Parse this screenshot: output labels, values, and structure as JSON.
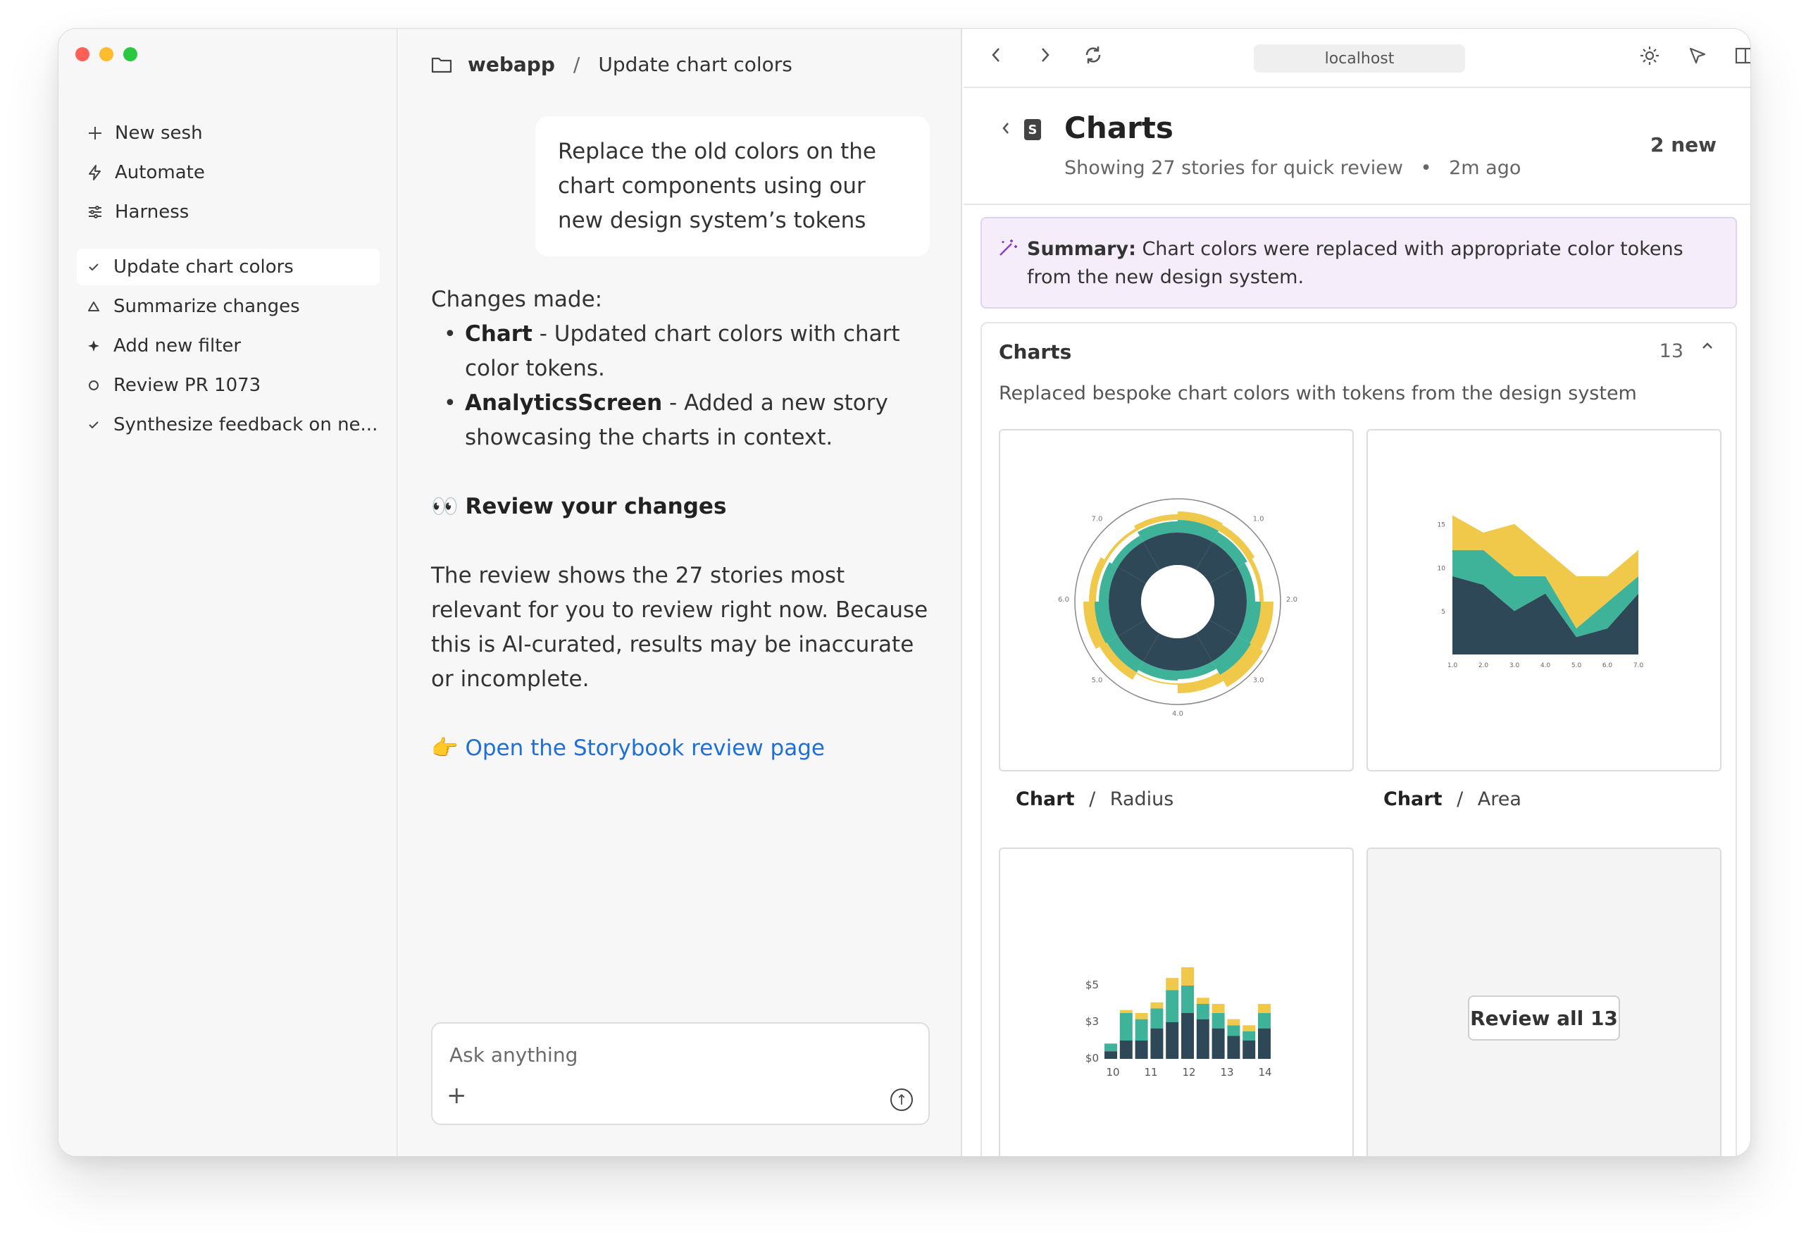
{
  "sidebar": {
    "actions": [
      {
        "label": "New sesh",
        "icon": "plus-icon"
      },
      {
        "label": "Automate",
        "icon": "bolt-icon"
      },
      {
        "label": "Harness",
        "icon": "sliders-icon"
      }
    ],
    "sessions": [
      {
        "label": "Update chart colors",
        "status": "check",
        "active": true
      },
      {
        "label": "Summarize changes",
        "status": "triangle"
      },
      {
        "label": "Add new filter",
        "status": "sparkle"
      },
      {
        "label": "Review PR 1073",
        "status": "circle"
      },
      {
        "label": "Synthesize feedback on ne...",
        "status": "check"
      }
    ]
  },
  "chat": {
    "breadcrumb": {
      "project": "webapp",
      "separator": "/",
      "title": "Update chart colors"
    },
    "user_message": "Replace the old colors on the chart components using our new design system’s tokens",
    "changes_heading": "Changes made:",
    "changes": [
      {
        "name": "Chart",
        "text": " - Updated chart colors with chart color tokens."
      },
      {
        "name": "AnalyticsScreen",
        "text": " - Added a new story showcasing the charts in context."
      }
    ],
    "review_heading": "Review your changes",
    "review_emoji": "👀",
    "review_text": "The review shows the 27 stories most relevant for you to review right now. Because this is AI-curated, results may be inaccurate or incomplete.",
    "link_emoji": "👉",
    "link_text": "Open the Storybook review page",
    "input_placeholder": "Ask anything"
  },
  "browser": {
    "url": "localhost",
    "title": "Charts",
    "subtitle": "Showing 27 stories for quick review",
    "time": "2m ago",
    "new_count": "2 new",
    "summary_label": "Summary:",
    "summary_text": " Chart colors were replaced with appropriate color tokens from the new design system.",
    "group": {
      "title": "Charts",
      "count": "13",
      "description": "Replaced bespoke chart colors with tokens from the design system"
    },
    "tiles": [
      {
        "component": "Chart",
        "sep": "/",
        "story": "Radius"
      },
      {
        "component": "Chart",
        "sep": "/",
        "story": "Area"
      }
    ],
    "review_all": "Review all 13"
  },
  "colors": {
    "dark": "#2f4858",
    "teal": "#3fb39a",
    "yellow": "#f0c94a",
    "link": "#1e6fd6",
    "summary_bg": "#f5eefa"
  },
  "chart_data": [
    {
      "type": "radial",
      "tick_labels": [
        "1.0",
        "2.0",
        "3.0",
        "4.0",
        "5.0",
        "6.0",
        "7.0"
      ]
    },
    {
      "type": "area",
      "x": [
        1,
        2,
        3,
        4,
        5,
        6,
        7
      ],
      "x_tick_labels": [
        "1.0",
        "2.0",
        "3.0",
        "4.0",
        "5.0",
        "6.0",
        "7.0"
      ],
      "y_tick_labels": [
        "5",
        "10",
        "15"
      ],
      "ylim": [
        0,
        17
      ],
      "series": [
        {
          "values": [
            9,
            8,
            5,
            7,
            2,
            3,
            7
          ]
        },
        {
          "values": [
            3,
            4,
            4,
            2,
            1,
            3,
            2
          ]
        },
        {
          "values": [
            4,
            2,
            6,
            3,
            6,
            3,
            3
          ]
        }
      ]
    },
    {
      "type": "bar",
      "x_tick_labels": [
        "10",
        "11",
        "12",
        "13",
        "14"
      ],
      "y_tick_labels": [
        "$0",
        "$3",
        "$5"
      ],
      "ylim": [
        0,
        6
      ],
      "series": [
        {
          "values": [
            0.5,
            1.2,
            1.2,
            2.0,
            2.4,
            3.0,
            2.6,
            2.0,
            1.5,
            1.2,
            2.0
          ]
        },
        {
          "values": [
            0.5,
            1.8,
            1.4,
            1.3,
            2.1,
            1.8,
            1.0,
            1.0,
            0.7,
            0.6,
            1.0
          ]
        },
        {
          "values": [
            0,
            0.2,
            0.4,
            0.4,
            0.8,
            1.2,
            0.4,
            0.6,
            0.4,
            0.4,
            0.6
          ]
        }
      ]
    }
  ]
}
